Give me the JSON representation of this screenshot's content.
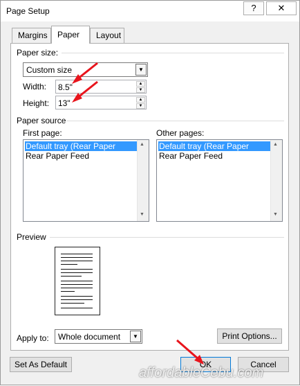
{
  "window": {
    "title": "Page Setup",
    "help_label": "?",
    "close_label": "✕"
  },
  "tabs": [
    {
      "label": "Margins",
      "active": false
    },
    {
      "label": "Paper",
      "active": true
    },
    {
      "label": "Layout",
      "active": false
    }
  ],
  "paper_size": {
    "section_label": "Paper size:",
    "selected": "Custom size",
    "width_label": "Width:",
    "width_value": "8.5\"",
    "height_label": "Height:",
    "height_value": "13\""
  },
  "paper_source": {
    "section_label": "Paper source",
    "first_page_label": "First page:",
    "other_pages_label": "Other pages:",
    "first_page_items": [
      "Default tray (Rear Paper Feed)",
      "Rear Paper Feed"
    ],
    "other_pages_items": [
      "Default tray (Rear Paper Feed)",
      "Rear Paper Feed"
    ],
    "first_page_selected_index": 0,
    "other_pages_selected_index": 0
  },
  "preview": {
    "section_label": "Preview"
  },
  "apply_to": {
    "label": "Apply to:",
    "selected": "Whole document"
  },
  "buttons": {
    "print_options": "Print Options...",
    "set_as_default": "Set As Default",
    "ok": "OK",
    "cancel": "Cancel"
  },
  "watermark": "affordableCebu.com",
  "colors": {
    "selection": "#3399ff",
    "annotation_arrow": "#e8141c",
    "default_button_border": "#0078d7"
  },
  "icons": {
    "dropdown": "chevron-down-icon",
    "spin_up": "triangle-up-icon",
    "spin_down": "triangle-down-icon"
  }
}
